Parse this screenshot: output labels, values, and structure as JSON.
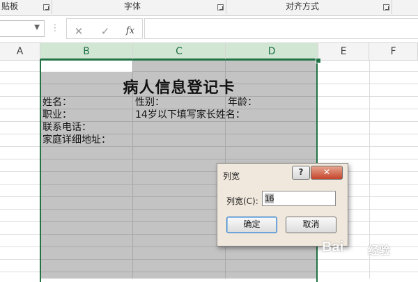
{
  "ribbon": {
    "groups": [
      {
        "label": "贴板"
      },
      {
        "label": "字体"
      },
      {
        "label": "对齐方式"
      }
    ]
  },
  "formula_bar": {
    "name_box_value": "",
    "cancel_icon": "close-icon",
    "enter_icon": "check-icon",
    "fx_label": "fx",
    "formula_value": ""
  },
  "columns": [
    "A",
    "B",
    "C",
    "D",
    "E",
    "F"
  ],
  "selected_columns": [
    "B",
    "C",
    "D"
  ],
  "sheet": {
    "title": "病人信息登记卡",
    "cells": {
      "name": "姓名：",
      "gender": "性别：",
      "age": "年龄：",
      "job": "职业：",
      "guardian": "14岁以下填写家长姓名：",
      "phone": "联系电话：",
      "address": "家庭详细地址："
    }
  },
  "dialog": {
    "title": "列宽",
    "help_label": "?",
    "close_label": "✕",
    "field_label": "列宽(C):",
    "field_value": "16",
    "ok_label": "确定",
    "cancel_label": "取消"
  },
  "watermark": {
    "text": "Bai",
    "sub": "经验"
  }
}
